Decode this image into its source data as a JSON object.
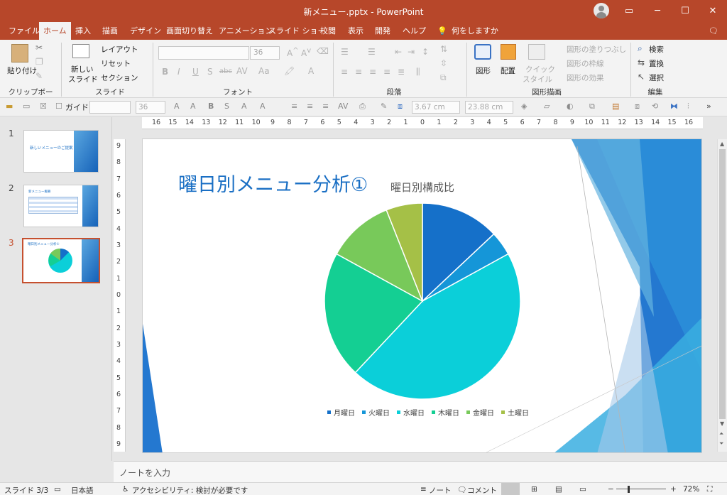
{
  "window": {
    "title": "新メニュー.pptx - PowerPoint"
  },
  "ribbon_tabs": [
    "ファイル",
    "ホーム",
    "挿入",
    "描画",
    "デザイン",
    "画面切り替え",
    "アニメーション",
    "スライド ショー",
    "校閲",
    "表示",
    "開発",
    "ヘルプ",
    "何をしますか"
  ],
  "ribbon": {
    "clipboard": {
      "paste": "貼り付け",
      "label": "クリップボード"
    },
    "slides": {
      "new_slide_1": "新しい",
      "new_slide_2": "スライド",
      "layout": "レイアウト",
      "reset": "リセット",
      "section": "セクション",
      "label": "スライド"
    },
    "font": {
      "size": "36",
      "label": "フォント"
    },
    "paragraph": {
      "label": "段落"
    },
    "drawing": {
      "shape": "図形",
      "arrange": "配置",
      "quick_1": "クイック",
      "quick_2": "スタイル",
      "fill": "図形の塗りつぶし",
      "outline": "図形の枠線",
      "effect": "図形の効果",
      "label": "図形描画"
    },
    "editing": {
      "find": "検索",
      "replace": "置換",
      "select": "選択",
      "label": "編集"
    }
  },
  "toolbar2": {
    "guide": "ガイド",
    "size": "36",
    "height": "3.67 cm",
    "width": "23.88 cm"
  },
  "thumbnails": [
    {
      "num": "1",
      "title": "新しいメニューのご提案"
    },
    {
      "num": "2",
      "title": "新メニュー概要"
    },
    {
      "num": "3",
      "title": "曜日別メニュー分析①"
    }
  ],
  "hruler_labels": [
    "16",
    "15",
    "14",
    "13",
    "12",
    "11",
    "10",
    "9",
    "8",
    "7",
    "6",
    "5",
    "4",
    "3",
    "2",
    "1",
    "0",
    "1",
    "2",
    "3",
    "4",
    "5",
    "6",
    "7",
    "8",
    "9",
    "10",
    "11",
    "12",
    "13",
    "14",
    "15",
    "16"
  ],
  "vruler_labels": [
    "9",
    "8",
    "7",
    "6",
    "5",
    "4",
    "3",
    "2",
    "1",
    "0",
    "1",
    "2",
    "3",
    "4",
    "5",
    "6",
    "7",
    "8",
    "9"
  ],
  "slide": {
    "title": "曜日別メニュー分析①",
    "chart_title": "曜日別構成比"
  },
  "chart_data": {
    "type": "pie",
    "title": "曜日別構成比",
    "categories": [
      "月曜日",
      "火曜日",
      "水曜日",
      "木曜日",
      "金曜日",
      "土曜日"
    ],
    "values": [
      13,
      4,
      45,
      21,
      11,
      6
    ],
    "colors": [
      "#1570c9",
      "#1596d8",
      "#0bcfd9",
      "#14cf93",
      "#78c95a",
      "#a5c047"
    ],
    "legend": "bottom"
  },
  "notes": {
    "placeholder": "ノートを入力"
  },
  "status": {
    "slide_info": "スライド 3/3",
    "language": "日本語",
    "accessibility": "アクセシビリティ: 検討が必要です",
    "notes": "ノート",
    "comments": "コメント",
    "zoom": "72%"
  }
}
